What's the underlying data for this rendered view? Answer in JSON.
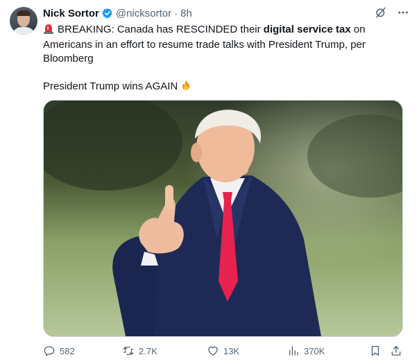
{
  "tweet": {
    "author": {
      "name": "Nick Sortor",
      "handle": "@nicksortor",
      "separator": "·",
      "time": "8h",
      "verified": true
    },
    "text": {
      "line1_prefix": "BREAKING: Canada has RESCINDED their ",
      "line1_bold": "digital service tax",
      "line1_suffix": " on Americans in an effort to resume trade talks with President Trump, per Bloomberg",
      "line2": "President Trump wins AGAIN"
    },
    "media": {
      "alt": "President Trump giving a thumbs up on a lawn"
    },
    "stats": {
      "replies": "582",
      "reposts": "2.7K",
      "likes": "13K",
      "views": "370K"
    }
  },
  "colors": {
    "text": "#0f1419",
    "secondary": "#536471",
    "verified": "#1d9bf0",
    "border": "#cfd9de"
  },
  "icons": [
    "grok-icon",
    "more-icon",
    "rotating-light-emoji",
    "fire-emoji",
    "reply-icon",
    "repost-icon",
    "like-icon",
    "views-icon",
    "bookmark-icon",
    "share-icon"
  ]
}
